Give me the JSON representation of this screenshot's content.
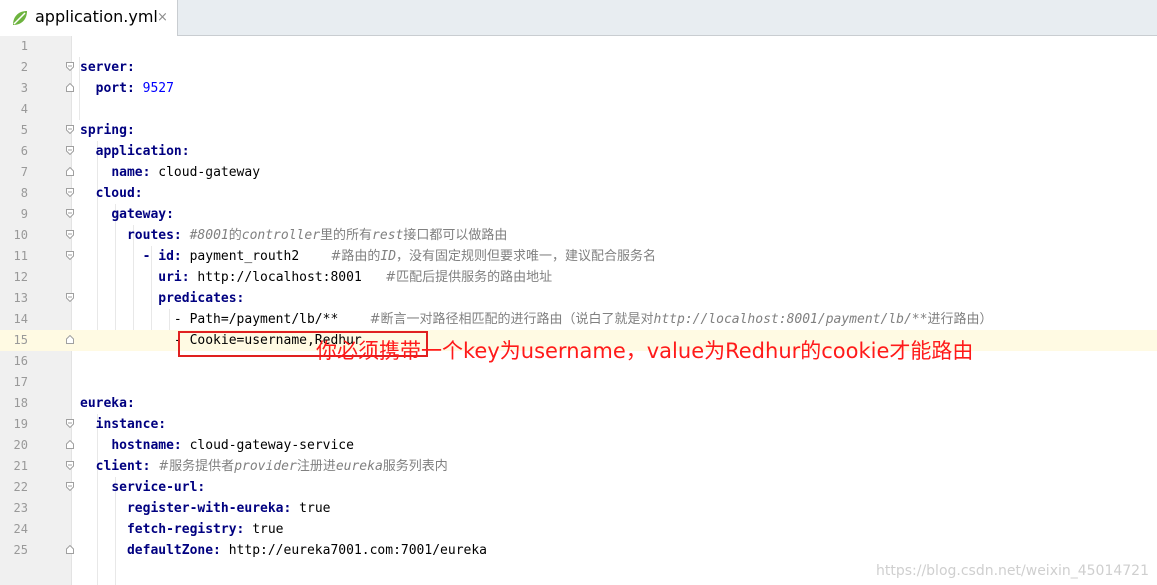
{
  "tab": {
    "label": "application.yml",
    "close": "×"
  },
  "lines": [
    {
      "no": "1"
    },
    {
      "no": "2"
    },
    {
      "no": "3"
    },
    {
      "no": "4"
    },
    {
      "no": "5"
    },
    {
      "no": "6"
    },
    {
      "no": "7"
    },
    {
      "no": "8"
    },
    {
      "no": "9"
    },
    {
      "no": "10"
    },
    {
      "no": "11"
    },
    {
      "no": "12"
    },
    {
      "no": "13"
    },
    {
      "no": "14"
    },
    {
      "no": "15"
    },
    {
      "no": "16"
    },
    {
      "no": "17"
    },
    {
      "no": "18"
    },
    {
      "no": "19"
    },
    {
      "no": "20"
    },
    {
      "no": "21"
    },
    {
      "no": "22"
    },
    {
      "no": "23"
    },
    {
      "no": "24"
    },
    {
      "no": "25"
    }
  ],
  "code": {
    "l2_key": "server:",
    "l3_key": "port:",
    "l3_val": "9527",
    "l5_key": "spring:",
    "l6_key": "application:",
    "l7_key": "name:",
    "l7_val": "cloud-gateway",
    "l8_key": "cloud:",
    "l9_key": "gateway:",
    "l10_key": "routes:",
    "l10_c1": "#8001",
    "l10_c2": "的",
    "l10_c3": "controller",
    "l10_c4": "里的所有",
    "l10_c5": "rest",
    "l10_c6": "接口都可以做路由",
    "l11_dash": "- ",
    "l11_key": "id:",
    "l11_val": "payment_routh2",
    "l11_c1": "#路由的",
    "l11_c2": "ID",
    "l11_c3": "，没有固定规则但要求唯一，建议配合服务名",
    "l12_key": "uri:",
    "l12_val": "http://localhost:8001",
    "l12_c1": "#匹配后提供服务的路由地址",
    "l13_key": "predicates:",
    "l14_val": "- Path=/payment/lb/**",
    "l14_c1": "#断言一对路径相匹配的进行路由（说白了就是对",
    "l14_c2": "http://localhost:8001/payment/lb/**",
    "l14_c3": "进行路由）",
    "l15_val": "- Cookie=username,Redhur",
    "l18_key": "eureka:",
    "l19_key": "instance:",
    "l20_key": "hostname:",
    "l20_val": "cloud-gateway-service",
    "l21_key": "client:",
    "l21_c1": "#服务提供者",
    "l21_c2": "provider",
    "l21_c3": "注册进",
    "l21_c4": "eureka",
    "l21_c5": "服务列表内",
    "l22_key": "service-url:",
    "l23_key": "register-with-eureka:",
    "l23_val": "true",
    "l24_key": "fetch-registry:",
    "l24_val": "true",
    "l25_key": "defaultZone:",
    "l25_val": "http://eureka7001.com:7001/eureka"
  },
  "annotation": "你必须携带一个key为username，value为Redhur的cookie才能路由",
  "watermark": "https://blog.csdn.net/weixin_45014721",
  "colors": {
    "key": "#000080",
    "number": "#0000ff",
    "comment": "#808080",
    "annotation": "#ff1a1a",
    "current_line": "#fffae3"
  }
}
